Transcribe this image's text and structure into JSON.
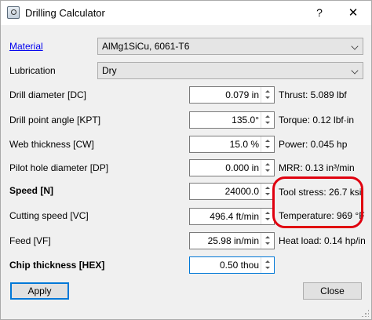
{
  "window": {
    "title": "Drilling Calculator",
    "help_label": "?",
    "close_label": "✕"
  },
  "material": {
    "label": "Material",
    "value": "AlMg1SiCu, 6061-T6"
  },
  "lubrication": {
    "label": "Lubrication",
    "value": "Dry"
  },
  "fields": [
    {
      "label": "Drill diameter [DC]",
      "value": "0.079 in",
      "result": "Thrust: 5.089 lbf"
    },
    {
      "label": "Drill point angle [KPT]",
      "value": "135.0°",
      "result": "Torque: 0.12 lbf·in"
    },
    {
      "label": "Web thickness [CW]",
      "value": "15.0 %",
      "result": "Power: 0.045 hp"
    },
    {
      "label": "Pilot hole diameter [DP]",
      "value": "0.000 in",
      "result": "MRR: 0.13 in³/min"
    },
    {
      "label": "Speed [N]",
      "value": "24000.0",
      "result": "Tool stress: 26.7 ksi"
    },
    {
      "label": "Cutting speed [VC]",
      "value": "496.4 ft/min",
      "result": "Temperature: 969 °F"
    },
    {
      "label": "Feed [VF]",
      "value": "25.98 in/min",
      "result": "Heat load: 0.14 hp/in"
    },
    {
      "label": "Chip thickness [HEX]",
      "value": "0.50 thou"
    }
  ],
  "buttons": {
    "apply": "Apply",
    "close": "Close"
  },
  "colors": {
    "annotation": "#e0000f",
    "link": "#0000ee",
    "focus": "#0078d7"
  }
}
